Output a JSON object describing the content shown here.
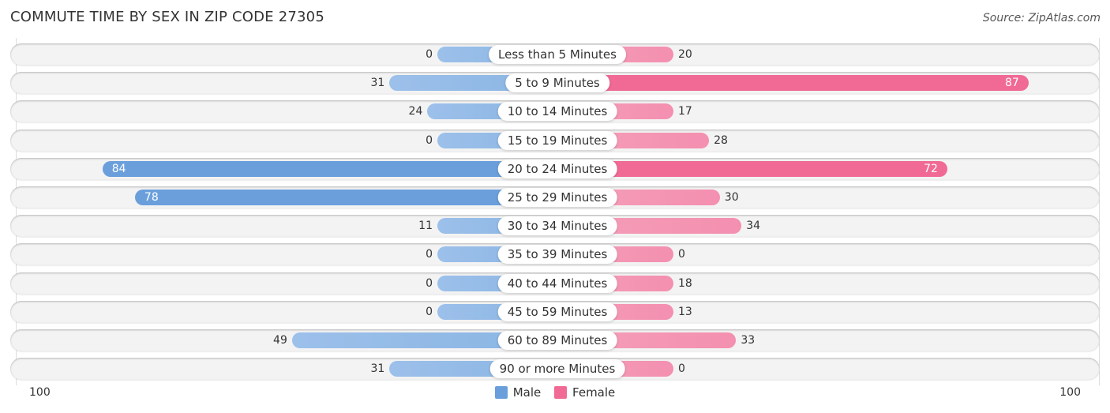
{
  "title": "COMMUTE TIME BY SEX IN ZIP CODE 27305",
  "source": "Source: ZipAtlas.com",
  "legend": [
    {
      "label": "Male",
      "color": "#6a9fdc"
    },
    {
      "label": "Female",
      "color": "#f06a95"
    }
  ],
  "axis": {
    "left_label": "100",
    "right_label": "100"
  },
  "chart_data": {
    "type": "bar",
    "orientation": "horizontal-diverging",
    "title": "COMMUTE TIME BY SEX IN ZIP CODE 27305",
    "categories": [
      "Less than 5 Minutes",
      "5 to 9 Minutes",
      "10 to 14 Minutes",
      "15 to 19 Minutes",
      "20 to 24 Minutes",
      "25 to 29 Minutes",
      "30 to 34 Minutes",
      "35 to 39 Minutes",
      "40 to 44 Minutes",
      "45 to 59 Minutes",
      "60 to 89 Minutes",
      "90 or more Minutes"
    ],
    "series": [
      {
        "name": "Male",
        "values": [
          0,
          31,
          24,
          0,
          84,
          78,
          11,
          0,
          0,
          0,
          49,
          31
        ]
      },
      {
        "name": "Female",
        "values": [
          20,
          87,
          17,
          28,
          72,
          30,
          34,
          0,
          18,
          13,
          33,
          0
        ]
      }
    ],
    "xlim": [
      -100,
      100
    ],
    "xtick_labels": [
      "100",
      "100"
    ],
    "legend_position": "bottom-center",
    "xlabel": "",
    "ylabel": ""
  }
}
